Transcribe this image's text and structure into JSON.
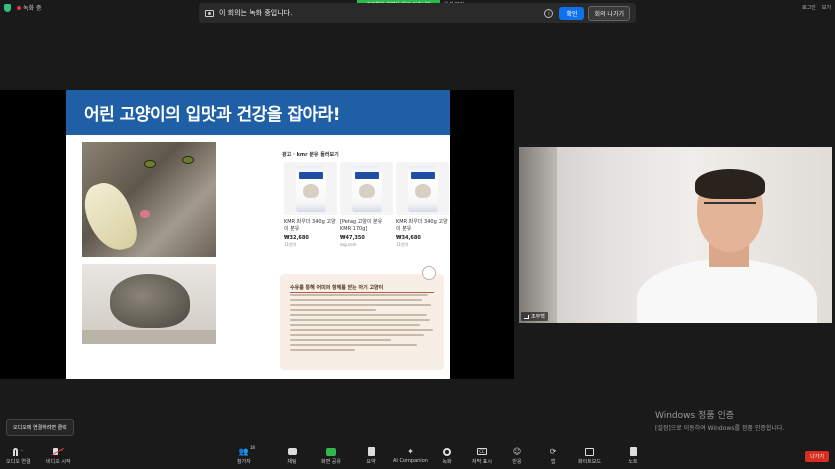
{
  "topbar": {
    "recording_label": "녹화 중",
    "share_banner": "조무혁이 화면을 하고 있습니다",
    "view_options": "옵션 보기",
    "meeting_recording_msg": "이 회의는 녹화 중입니다.",
    "ok_label": "확인",
    "leave_meeting_label": "회의 나가기",
    "right_items": [
      "로그인",
      "보기"
    ]
  },
  "slide": {
    "title": "어린 고양이의 입맛과 건강을 잡아라!",
    "ad_title": "광고 · kmr 분유 둘러보기",
    "products": [
      {
        "name": "KMR 파우더 340g 고양이 분유",
        "price": "₩32,680",
        "sub": "11번가"
      },
      {
        "name": "[Petag 고양이 분유 KMR 170g]",
        "price": "₩47,350",
        "sub": "ssg.com"
      },
      {
        "name": "KMR 파우더 340g 고양이 분유",
        "price": "₩34,680",
        "sub": "11번가"
      }
    ],
    "article_title": "수유를 통해 어미의 항체를 받는 아기 고양이"
  },
  "camera": {
    "participant_name": "조무혁"
  },
  "watermark": {
    "line1": "Windows 정품 인증",
    "line2": "[설정]으로 이동하여 Windows를 정품 인증합니다."
  },
  "tooltip": "오디오에 연결하려면 클릭",
  "toolbar": {
    "items": [
      {
        "label": "오디오 연결"
      },
      {
        "label": "비디오 시작"
      },
      {
        "label": "참가자",
        "badge": "18"
      },
      {
        "label": "채팅"
      },
      {
        "label": "화면 공유"
      },
      {
        "label": "요약"
      },
      {
        "label": "AI Companion"
      },
      {
        "label": "녹화"
      },
      {
        "label": "자막 표시"
      },
      {
        "label": "반응"
      },
      {
        "label": "앱"
      },
      {
        "label": "화이트보드"
      },
      {
        "label": "노트"
      }
    ],
    "leave_label": "나가기"
  },
  "colors": {
    "slide_header": "#1f5fa6",
    "share_green": "#2db84c",
    "confirm_blue": "#0e72ed",
    "leave_red": "#d92d20"
  }
}
